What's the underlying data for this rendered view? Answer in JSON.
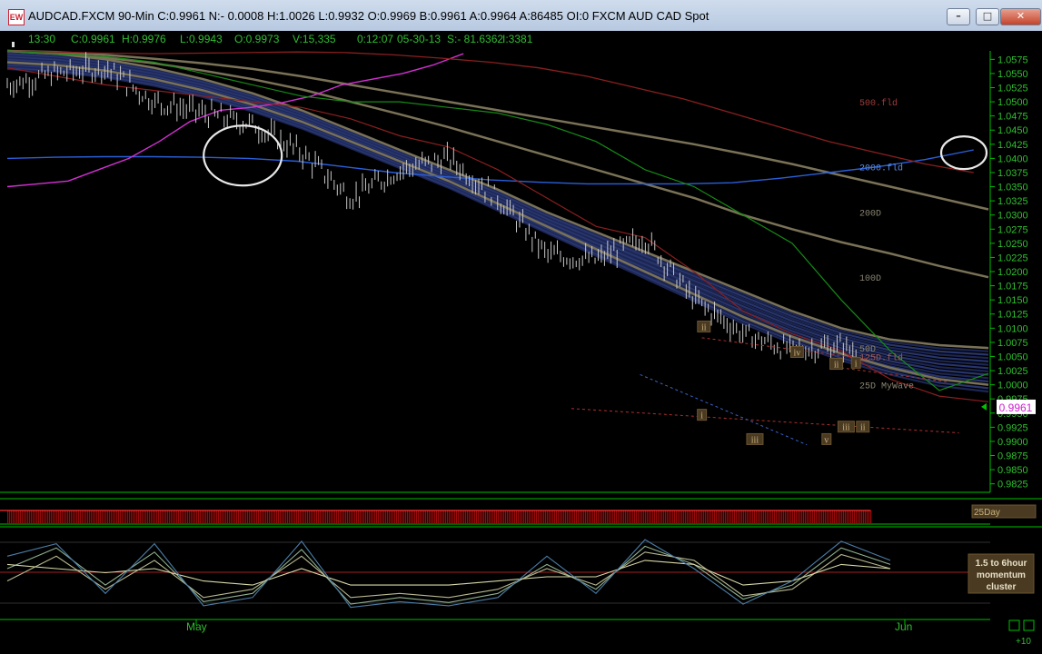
{
  "window": {
    "title": "AUDCAD.FXCM 90-Min C:0.9961 N:- 0.0008 H:1.0026 L:0.9932 O:0.9969 B:0.9961 A:0.9964 A:86485 OI:0 FXCM AUD CAD Spot",
    "minimize_label": "–",
    "maximize_label": "□",
    "close_label": "✕"
  },
  "info_bar": [
    "13:30",
    "C:0.9961",
    "H:0.9976",
    "L:0.9943",
    "O:0.9973",
    "V:15,335",
    "0:12:07",
    "05-30-13",
    "S:- 81.6362",
    "I:3381"
  ],
  "colors": {
    "price_bar": "#c8c8c8",
    "axis_green": "#00c000",
    "ribbon": "#22306a",
    "ma_tan": "#7a7257",
    "ma_blue": "#2a5fd8",
    "magenta": "#d430d4",
    "dark_red": "#8a1f1f",
    "green_line": "#168a16",
    "momentum_lines": [
      "#8fb08f",
      "#b8b890",
      "#d8d8a8",
      "#4b7da8",
      "#a07a5a"
    ]
  },
  "chart_data": [
    {
      "type": "line",
      "title": "AUDCAD.FXCM 90-Min",
      "x_labels": [
        "May",
        "Jun"
      ],
      "ylim": [
        0.981,
        1.059
      ],
      "y_ticks": [
        "1.0575",
        "1.0550",
        "1.0525",
        "1.0500",
        "1.0475",
        "1.0450",
        "1.0425",
        "1.0400",
        "1.0375",
        "1.0350",
        "1.0325",
        "1.0300",
        "1.0275",
        "1.0250",
        "1.0225",
        "1.0200",
        "1.0175",
        "1.0150",
        "1.0125",
        "1.0100",
        "1.0075",
        "1.0050",
        "1.0025",
        "1.0000",
        "0.9975",
        "0.9950",
        "0.9925",
        "0.9900",
        "0.9875",
        "0.9850",
        "0.9825"
      ],
      "last_price": "0.9961",
      "x": [
        0,
        5,
        10,
        15,
        20,
        25,
        30,
        35,
        40,
        45,
        50,
        55,
        60,
        65,
        70,
        75,
        80,
        85,
        90,
        95,
        100
      ],
      "series": [
        {
          "key": "price",
          "values": [
            1.053,
            1.055,
            1.056,
            1.05,
            1.048,
            1.046,
            1.041,
            1.033,
            1.038,
            1.04,
            1.033,
            1.023,
            1.022,
            1.026,
            1.015,
            1.009,
            1.006,
            1.007,
            1.003,
            0.997,
            1.005
          ]
        },
        {
          "key": "25D MyWave",
          "values": [
            1.057,
            1.0565,
            1.0555,
            1.054,
            1.052,
            1.0495,
            1.0465,
            1.043,
            1.0395,
            1.036,
            1.032,
            1.028,
            1.024,
            1.02,
            1.016,
            1.012,
            1.0085,
            1.0055,
            1.003,
            1.001,
            1.0
          ]
        },
        {
          "key": "50D",
          "values": [
            1.059,
            1.0585,
            1.0575,
            1.056,
            1.054,
            1.0515,
            1.0485,
            1.045,
            1.0415,
            1.038,
            1.0345,
            1.0305,
            1.027,
            1.0235,
            1.02,
            1.0165,
            1.013,
            1.01,
            1.008,
            1.007,
            1.0065
          ]
        },
        {
          "key": "100D",
          "values": [
            1.059,
            1.0585,
            1.0578,
            1.0568,
            1.0555,
            1.054,
            1.0522,
            1.05,
            1.0478,
            1.0455,
            1.043,
            1.0405,
            1.038,
            1.0355,
            1.033,
            1.03,
            1.0275,
            1.0252,
            1.0232,
            1.021,
            1.019
          ]
        },
        {
          "key": "200D",
          "values": [
            1.059,
            1.0588,
            1.0583,
            1.0576,
            1.0568,
            1.0558,
            1.0545,
            1.053,
            1.0515,
            1.05,
            1.0485,
            1.047,
            1.0455,
            1.044,
            1.0425,
            1.0408,
            1.039,
            1.037,
            1.035,
            1.033,
            1.031
          ]
        },
        {
          "key": "2000.fld",
          "values": [
            1.04,
            1.0402,
            1.0403,
            1.0403,
            1.0402,
            1.04,
            1.0395,
            1.0385,
            1.0375,
            1.0368,
            1.0362,
            1.0358,
            1.0355,
            1.0355,
            1.0355,
            1.0357,
            1.0365,
            1.0375,
            1.0385,
            1.0398,
            1.0415
          ]
        },
        {
          "key": "magenta",
          "values": [
            1.035,
            1.0355,
            1.036,
            1.038,
            1.04,
            1.043,
            1.0465,
            1.0485,
            1.049,
            1.0498,
            1.051,
            1.053,
            1.054,
            1.055,
            1.0565,
            1.0585
          ]
        },
        {
          "key": "500.fld",
          "values": [
            1.059,
            1.0588,
            1.0586,
            1.0585,
            1.0586,
            1.0587,
            1.0588,
            1.0587,
            1.0583,
            1.0577,
            1.057,
            1.056,
            1.0545,
            1.0525,
            1.0505,
            1.048,
            1.0455,
            1.043,
            1.041,
            1.039,
            1.0375
          ]
        },
        {
          "key": "125D.fld",
          "values": [
            1.056,
            1.0545,
            1.053,
            1.052,
            1.051,
            1.05,
            1.049,
            1.047,
            1.044,
            1.042,
            1.038,
            1.033,
            1.028,
            1.026,
            1.02,
            1.013,
            1.009,
            1.006,
            1.001,
            0.998,
            0.997
          ]
        },
        {
          "key": "green",
          "values": [
            1.059,
            1.0585,
            1.058,
            1.057,
            1.055,
            1.053,
            1.051,
            1.05,
            1.05,
            1.049,
            1.048,
            1.046,
            1.043,
            1.038,
            1.035,
            1.03,
            1.025,
            1.015,
            1.006,
            0.999,
            1.002
          ]
        }
      ],
      "labels": [
        {
          "text": "500.fld",
          "series": "500.fld",
          "y": 1.05,
          "color": "#a03a3a"
        },
        {
          "text": "2000.fld",
          "series": "2000.fld",
          "y": 1.0385,
          "color": "#5b8ee8"
        },
        {
          "text": "200D",
          "series": "200D",
          "y": 1.0305,
          "color": "#8a8470"
        },
        {
          "text": "100D",
          "series": "100D",
          "y": 1.019,
          "color": "#8a8470"
        },
        {
          "text": "50D",
          "series": "50D",
          "y": 1.0065,
          "color": "#8a8470"
        },
        {
          "text": "125D.fld",
          "series": "125D.fld",
          "y": 1.005,
          "color": "#a05a5a"
        },
        {
          "text": "25D MyWave",
          "series": "25D MyWave",
          "y": 1.0,
          "color": "#8a8470"
        }
      ],
      "annotations": [
        {
          "text": "ii",
          "x": 71.0,
          "y": 1.0103
        },
        {
          "text": "iv",
          "x": 80.5,
          "y": 1.0058
        },
        {
          "text": "ii",
          "x": 84.5,
          "y": 1.0037
        },
        {
          "text": "i",
          "x": 86.5,
          "y": 1.0039
        },
        {
          "text": "i",
          "x": 70.8,
          "y": 0.9947
        },
        {
          "text": "iii",
          "x": 76.2,
          "y": 0.9904
        },
        {
          "text": "v",
          "x": 83.5,
          "y": 0.9904
        },
        {
          "text": "iii",
          "x": 85.5,
          "y": 0.9926
        },
        {
          "text": "ii",
          "x": 87.2,
          "y": 0.9926
        }
      ],
      "circles": [
        {
          "x": 24.0,
          "y": 1.0405
        },
        {
          "x": 97.5,
          "y": 1.041
        }
      ]
    },
    {
      "type": "heatmap",
      "legend": "25Day",
      "x": [
        0,
        20,
        40,
        60,
        80,
        88
      ],
      "values": [
        0.45,
        0.55,
        0.6,
        0.5,
        0.55,
        0.5
      ]
    },
    {
      "type": "line",
      "legend": [
        "1.5 to 6hour",
        "momentum",
        "cluster"
      ],
      "ylim": [
        0,
        100
      ],
      "x": [
        0,
        5,
        10,
        15,
        20,
        25,
        30,
        35,
        40,
        45,
        50,
        55,
        60,
        65,
        70,
        75,
        80,
        85,
        90
      ],
      "series": [
        {
          "key": "m1",
          "values": [
            55,
            80,
            35,
            75,
            15,
            25,
            78,
            12,
            20,
            14,
            25,
            60,
            30,
            82,
            60,
            18,
            35,
            80,
            60
          ]
        },
        {
          "key": "m2",
          "values": [
            40,
            70,
            30,
            65,
            20,
            30,
            70,
            20,
            25,
            20,
            30,
            55,
            35,
            75,
            65,
            22,
            30,
            72,
            55
          ]
        },
        {
          "key": "m3",
          "values": [
            60,
            55,
            50,
            55,
            40,
            35,
            55,
            35,
            35,
            35,
            40,
            45,
            45,
            65,
            60,
            35,
            40,
            60,
            55
          ]
        },
        {
          "key": "m4",
          "values": [
            70,
            85,
            25,
            85,
            10,
            20,
            88,
            8,
            15,
            10,
            20,
            70,
            25,
            90,
            55,
            12,
            40,
            88,
            65
          ]
        }
      ]
    }
  ],
  "bottom_right": {
    "label": "+10"
  }
}
